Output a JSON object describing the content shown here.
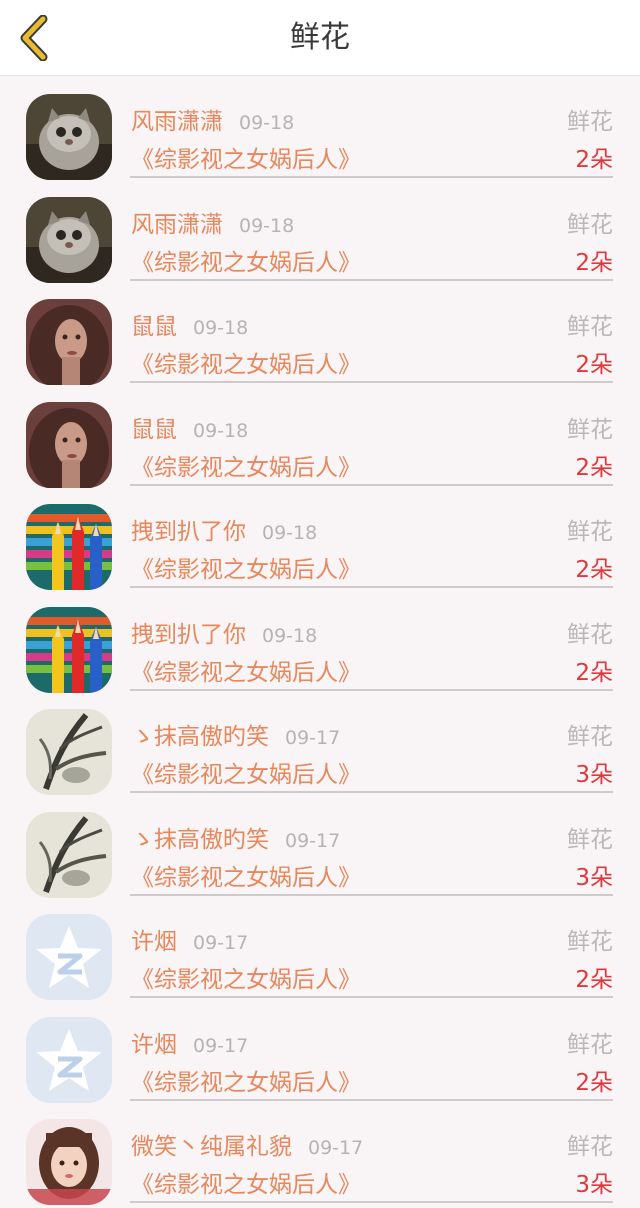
{
  "header": {
    "title": "鲜花",
    "back_icon": "chevron-left-icon",
    "accent": "#e9bb2f"
  },
  "colors": {
    "name": "#e8875b",
    "count": "#e0383b",
    "muted": "#bbb6b7"
  },
  "rows": [
    {
      "name": "风雨潇潇",
      "date": "09-18",
      "book": "《综影视之女娲后人》",
      "gift": "鲜花",
      "count": "2朵",
      "avatar": "cat-avatar"
    },
    {
      "name": "风雨潇潇",
      "date": "09-18",
      "book": "《综影视之女娲后人》",
      "gift": "鲜花",
      "count": "2朵",
      "avatar": "cat-avatar"
    },
    {
      "name": "鼠鼠",
      "date": "09-18",
      "book": "《综影视之女娲后人》",
      "gift": "鲜花",
      "count": "2朵",
      "avatar": "woman-portrait-avatar"
    },
    {
      "name": "鼠鼠",
      "date": "09-18",
      "book": "《综影视之女娲后人》",
      "gift": "鲜花",
      "count": "2朵",
      "avatar": "woman-portrait-avatar"
    },
    {
      "name": "拽到扒了你",
      "date": "09-18",
      "book": "《综影视之女娲后人》",
      "gift": "鲜花",
      "count": "2朵",
      "avatar": "colored-pencils-avatar"
    },
    {
      "name": "拽到扒了你",
      "date": "09-18",
      "book": "《综影视之女娲后人》",
      "gift": "鲜花",
      "count": "2朵",
      "avatar": "colored-pencils-avatar"
    },
    {
      "name": "ゝ抹高傲旳笑",
      "date": "09-17",
      "book": "《综影视之女娲后人》",
      "gift": "鲜花",
      "count": "3朵",
      "avatar": "ink-painting-avatar"
    },
    {
      "name": "ゝ抹高傲旳笑",
      "date": "09-17",
      "book": "《综影视之女娲后人》",
      "gift": "鲜花",
      "count": "3朵",
      "avatar": "ink-painting-avatar"
    },
    {
      "name": "许烟",
      "date": "09-17",
      "book": "《综影视之女娲后人》",
      "gift": "鲜花",
      "count": "2朵",
      "avatar": "default-star-avatar"
    },
    {
      "name": "许烟",
      "date": "09-17",
      "book": "《综影视之女娲后人》",
      "gift": "鲜花",
      "count": "2朵",
      "avatar": "default-star-avatar"
    },
    {
      "name": "微笑丶纯属礼貌",
      "date": "09-17",
      "book": "《综影视之女娲后人》",
      "gift": "鲜花",
      "count": "3朵",
      "avatar": "girl-photo-avatar"
    }
  ]
}
